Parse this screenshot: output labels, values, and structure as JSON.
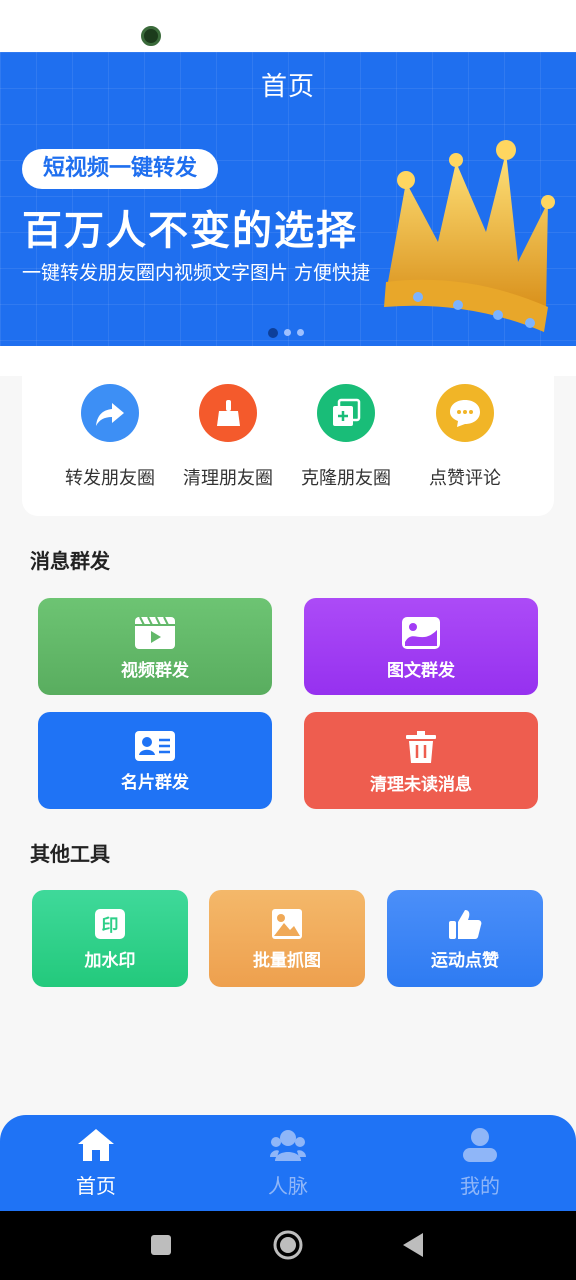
{
  "header": {
    "title": "首页"
  },
  "banner": {
    "pill": "短视频一键转发",
    "headline": "百万人不变的选择",
    "subline": "一键转发朋友圈内视频文字图片 方便快捷"
  },
  "quick_actions": [
    {
      "label": "转发朋友圈",
      "icon": "share-arrow-icon",
      "color": "#3d8ff5"
    },
    {
      "label": "清理朋友圈",
      "icon": "broom-icon",
      "color": "#f45a2c"
    },
    {
      "label": "克隆朋友圈",
      "icon": "clone-icon",
      "color": "#19bd78"
    },
    {
      "label": "点赞评论",
      "icon": "chat-bubble-icon",
      "color": "#f1b527"
    }
  ],
  "sections": {
    "mass_message": "消息群发",
    "other_tools": "其他工具"
  },
  "mass_tiles": [
    {
      "label": "视频群发",
      "icon": "video-icon",
      "color": "#63b86a"
    },
    {
      "label": "图文群发",
      "icon": "image-icon",
      "color": "#a23cf5"
    },
    {
      "label": "名片群发",
      "icon": "contact-card-icon",
      "color": "#1f73f5"
    },
    {
      "label": "清理未读消息",
      "icon": "trash-icon",
      "color": "#ee5d4f"
    }
  ],
  "tool_tiles": [
    {
      "label": "加水印",
      "icon": "stamp-icon",
      "color": "#2dcf88"
    },
    {
      "label": "批量抓图",
      "icon": "picture-icon",
      "color": "#f0a957"
    },
    {
      "label": "运动点赞",
      "icon": "thumbs-up-icon",
      "color": "#3f86f7"
    }
  ],
  "tabs": [
    {
      "label": "首页",
      "icon": "home-icon",
      "active": true
    },
    {
      "label": "人脉",
      "icon": "contacts-icon",
      "active": false
    },
    {
      "label": "我的",
      "icon": "profile-icon",
      "active": false
    }
  ],
  "colors": {
    "brand": "#1f73f5",
    "tab_inactive": "#8fb6f8"
  }
}
